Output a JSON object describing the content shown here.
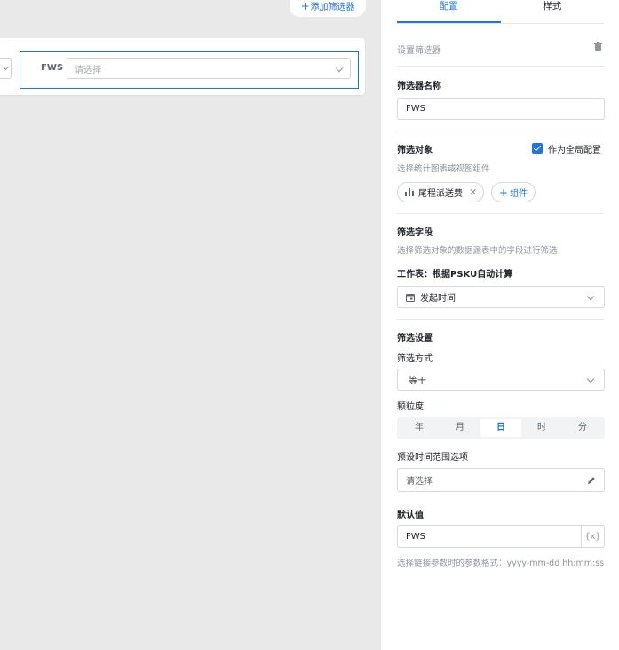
{
  "canvas": {
    "add_filter_label": "添加筛选器",
    "filter_item_label": "FWS",
    "filter_item_placeholder": "请选择"
  },
  "panel": {
    "tabs": [
      {
        "label": "配置",
        "active": true
      },
      {
        "label": "样式",
        "active": false
      }
    ],
    "settings_header": "设置筛选器",
    "name_section": {
      "title": "筛选器名称",
      "value": "FWS"
    },
    "target_section": {
      "title": "筛选对象",
      "global_checkbox_label": "作为全局配置",
      "global_checked": true,
      "hint": "选择统计图表或视图组件",
      "selected_object": "尾程派送费",
      "add_component_label": "组件"
    },
    "field_section": {
      "title": "筛选字段",
      "hint": "选择筛选对象的数据源表中的字段进行筛选",
      "worksheet_label": "工作表：根据PSKU自动计算",
      "selected_field": "发起时间"
    },
    "filter_settings": {
      "title": "筛选设置",
      "method_label": "筛选方式",
      "method_value": "等于",
      "granularity_label": "颗粒度",
      "granularity_options": [
        "年",
        "月",
        "日",
        "时",
        "分"
      ],
      "granularity_selected": "日",
      "preset_range_label": "预设时间范围选项",
      "preset_range_placeholder": "请选择"
    },
    "default_section": {
      "title": "默认值",
      "value": "FWS",
      "fx_label": "{x}",
      "hint": "选择链接参数时的参数格式：yyyy-mm-dd hh:mm:ss"
    }
  },
  "colors": {
    "accent": "#1e73e8",
    "canvas_bg": "#e9e9e9",
    "muted_text": "#8f959e"
  }
}
